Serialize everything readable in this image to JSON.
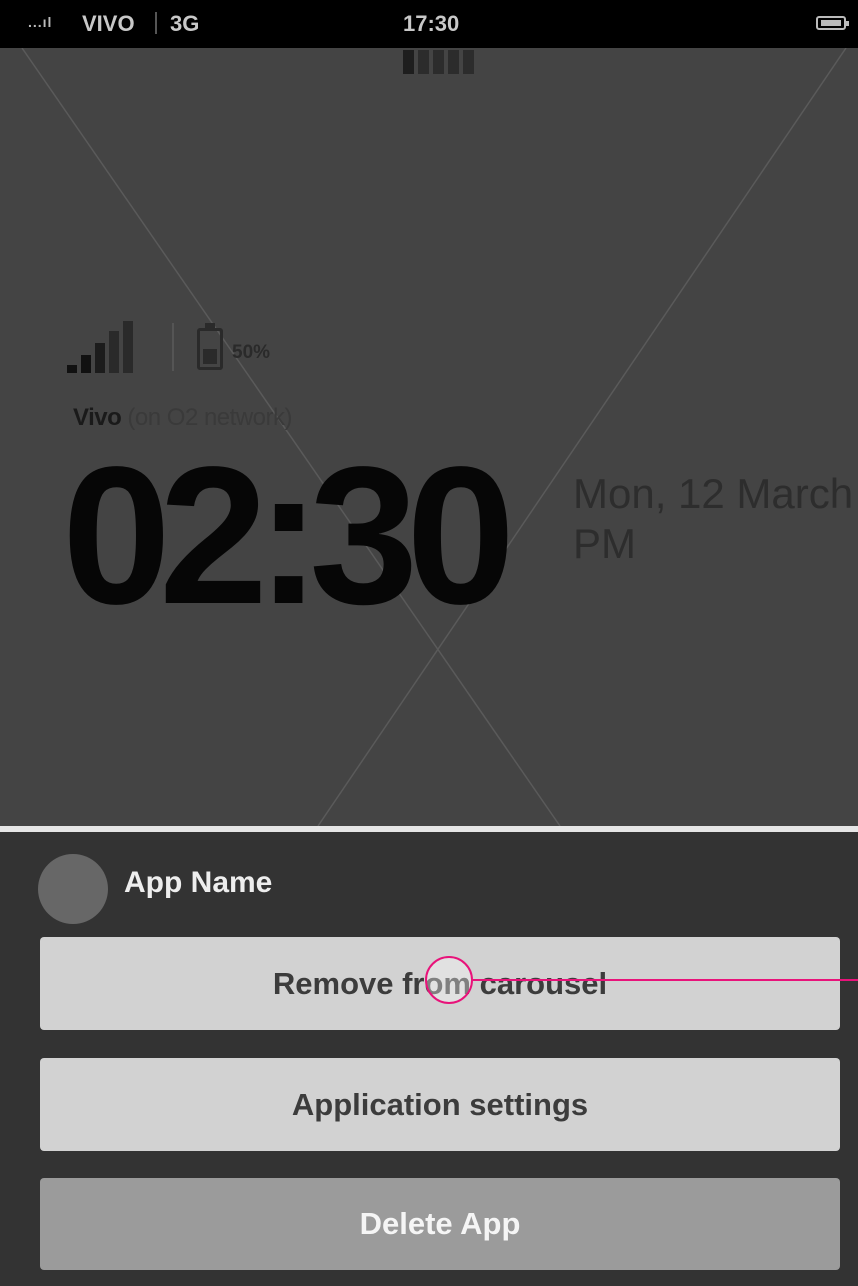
{
  "status_bar": {
    "signal": "...ıl",
    "carrier": "VIVO",
    "network": "3G",
    "time": "17:30",
    "battery_icon": "battery-icon"
  },
  "page_indicator": {
    "count": 5,
    "active_index": 0
  },
  "lockscreen": {
    "battery_percent": "50%",
    "carrier_name": "Vivo",
    "carrier_note": "(on O2 network)",
    "time": "02:30",
    "date": "Mon, 12 March",
    "ampm": "PM",
    "signal_icon": "signal-bars-icon"
  },
  "sheet": {
    "app_name": "App Name",
    "buttons": {
      "remove": "Remove from carousel",
      "settings": "Application settings",
      "delete": "Delete App"
    }
  },
  "colors": {
    "background": "#444444",
    "sheet": "#333333",
    "button": "#d2d2d2",
    "delete_button": "#9b9b9b",
    "touch_marker": "#e8137a"
  }
}
